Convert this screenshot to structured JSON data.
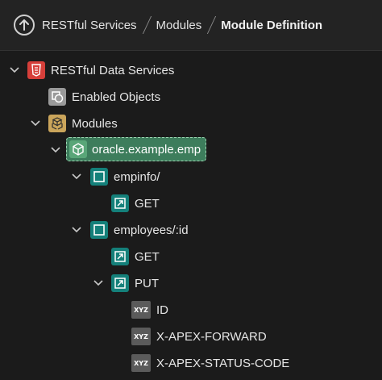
{
  "breadcrumb": {
    "items": [
      {
        "label": "RESTful Services"
      },
      {
        "label": "Modules"
      },
      {
        "label": "Module Definition"
      }
    ]
  },
  "tree": {
    "root": {
      "label": "RESTful Data Services",
      "icon": "rest-services-icon"
    },
    "enabled_objects": {
      "label": "Enabled Objects",
      "icon": "enabled-objects-icon"
    },
    "modules": {
      "label": "Modules",
      "icon": "modules-icon"
    },
    "module": {
      "label": "oracle.example.emp",
      "icon": "module-icon"
    },
    "template_1": {
      "label": "empinfo/",
      "icon": "template-icon"
    },
    "template_1_handler": {
      "label": "GET",
      "icon": "handler-icon"
    },
    "template_2": {
      "label": "employees/:id",
      "icon": "template-icon"
    },
    "template_2_get": {
      "label": "GET",
      "icon": "handler-icon"
    },
    "template_2_put": {
      "label": "PUT",
      "icon": "handler-icon"
    },
    "params": [
      {
        "label": "ID",
        "icon": "parameter-icon",
        "badge": "XYZ"
      },
      {
        "label": "X-APEX-FORWARD",
        "icon": "parameter-icon",
        "badge": "XYZ"
      },
      {
        "label": "X-APEX-STATUS-CODE",
        "icon": "parameter-icon",
        "badge": "XYZ"
      }
    ]
  },
  "colors": {
    "background": "#1b1b1b",
    "selected": "#3d7d5c",
    "rest_icon": "#d63f3a",
    "modules_icon": "#caa55b",
    "module_icon": "#59a678",
    "template_icon": "#14807a"
  }
}
